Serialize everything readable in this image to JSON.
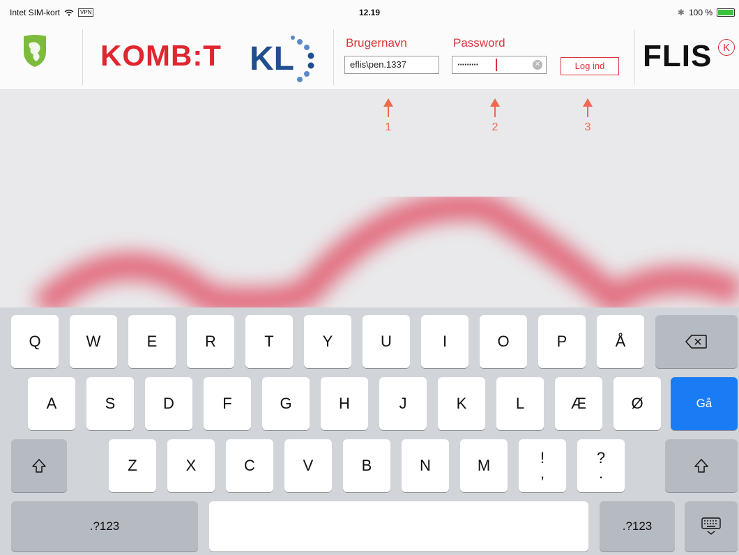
{
  "status_bar": {
    "carrier": "Intet SIM-kort",
    "vpn": "VPN",
    "time": "12.19",
    "battery": "100 %"
  },
  "header": {
    "kombit_logo": "KOMB:T",
    "username_label": "Brugernavn",
    "username_value": "eflis\\pen.1337",
    "password_label": "Password",
    "password_value": "·········",
    "login_button": "Log ind",
    "flis_logo": "FLIS",
    "flis_mark": "K"
  },
  "annotations": [
    "1",
    "2",
    "3"
  ],
  "colors": {
    "accent": "#d9343b",
    "annotation": "#ec6a4e",
    "go_key": "#1a7cf5"
  },
  "keyboard": {
    "row1": [
      "Q",
      "W",
      "E",
      "R",
      "T",
      "Y",
      "U",
      "I",
      "O",
      "P",
      "Å"
    ],
    "row2": [
      "A",
      "S",
      "D",
      "F",
      "G",
      "H",
      "J",
      "K",
      "L",
      "Æ",
      "Ø"
    ],
    "go": "Gå",
    "row3": [
      "Z",
      "X",
      "C",
      "V",
      "B",
      "N",
      "M"
    ],
    "excl_top": "!",
    "excl_bottom": ",",
    "quest_top": "?",
    "quest_bottom": ".",
    "numbers_left": ".?123",
    "numbers_right": ".?123"
  }
}
